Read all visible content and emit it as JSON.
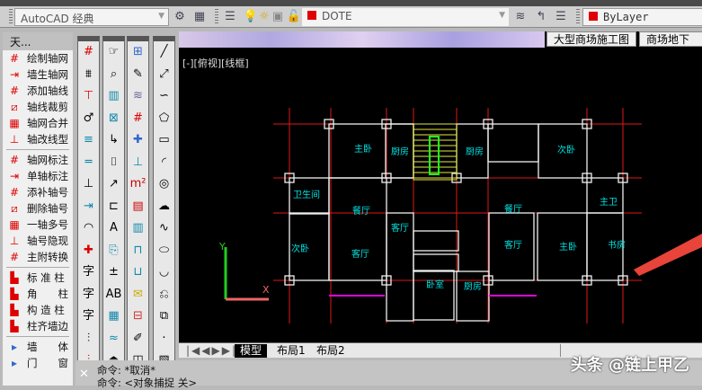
{
  "toolbar": {
    "workspace": "AutoCAD 经典",
    "layer": "DOTE",
    "color": "ByLayer",
    "color_swatch": "#e00000"
  },
  "file_tabs": [
    "大型商场施工图",
    "商场地下停"
  ],
  "viewport_label": "[-][俯视][线框]",
  "palette": {
    "title": "天...",
    "groups": [
      [
        "绘制轴网",
        "墙生轴网",
        "添加轴线",
        "轴线裁剪",
        "轴网合并",
        "轴改线型"
      ],
      [
        "轴网标注",
        "单轴标注",
        "添补轴号",
        "删除轴号",
        "一轴多号",
        "轴号隐现",
        "主附转换"
      ],
      [
        "标 准 柱",
        "角　　柱",
        "构 造 柱",
        "柱齐墙边"
      ],
      [
        "墙　　体",
        "门　　窗"
      ]
    ]
  },
  "layout_tabs": [
    "模型",
    "布局1",
    "布局2"
  ],
  "active_tab": "模型",
  "command": {
    "line1": "命令: *取消*",
    "line2": "命令: <对象捕捉 关>"
  },
  "watermark": "头条 @链上甲乙",
  "floorplan": {
    "rooms": [
      "主卧",
      "厨房",
      "厨房",
      "次卧",
      "卫生间",
      "餐厅",
      "客厅",
      "餐厅",
      "主卫",
      "次卧",
      "客厅",
      "客厅",
      "主卧",
      "书房",
      "卧室",
      "厨房"
    ]
  }
}
